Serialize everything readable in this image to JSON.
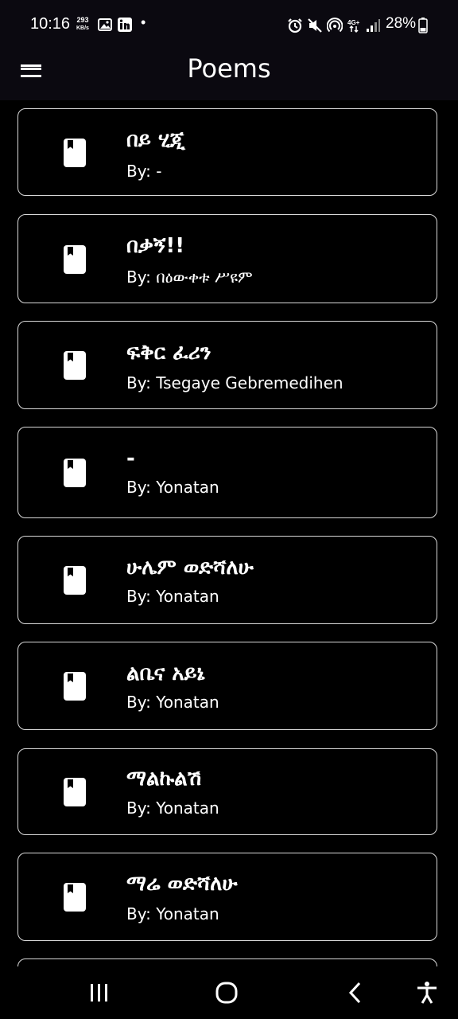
{
  "status": {
    "time": "10:16",
    "net_speed_value": "293",
    "net_speed_unit": "KB/s",
    "dot": "•",
    "battery": "28%"
  },
  "app_bar": {
    "title": "Poems"
  },
  "poems": [
    {
      "title": "በይ ሂጂ",
      "author": "By: -"
    },
    {
      "title": "በቃኝ!!",
      "author": "By: በዕውቀቱ ሥዩም"
    },
    {
      "title": "ፍቅር ፈሪን",
      "author": "By: Tsegaye Gebremedihen"
    },
    {
      "title": "-",
      "author": "By: Yonatan"
    },
    {
      "title": "ሁሌም ወድሻለሁ",
      "author": "By: Yonatan"
    },
    {
      "title": "ልቤና አይኔ",
      "author": "By: Yonatan"
    },
    {
      "title": "ማልኩልሽ",
      "author": "By: Yonatan"
    },
    {
      "title": "ማሬ ወድሻለሁ",
      "author": "By: Yonatan"
    },
    {
      "title": "",
      "author": ""
    }
  ],
  "icons": {
    "menu": "hamburger-menu-icon",
    "poem": "book-icon",
    "recents": "recent-apps-icon",
    "home": "home-icon",
    "back": "back-icon",
    "accessibility": "accessibility-icon"
  }
}
